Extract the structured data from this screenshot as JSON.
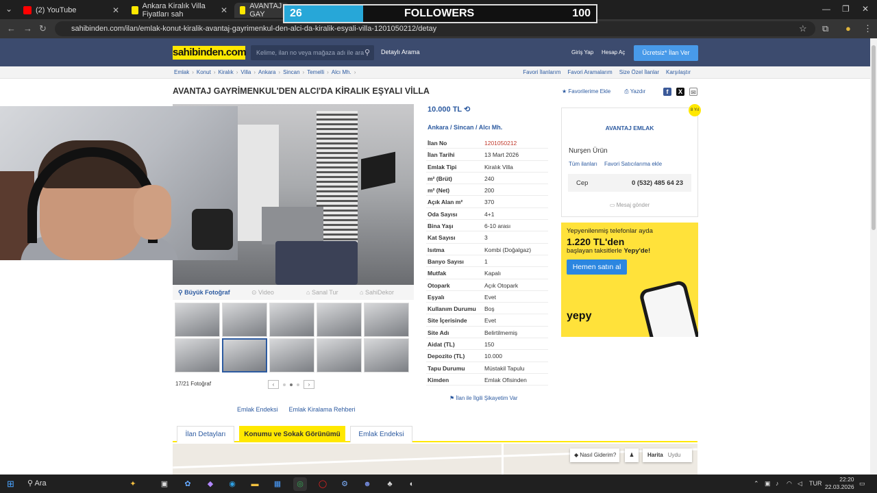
{
  "browser": {
    "tabs": [
      {
        "title": "(2) YouTube"
      },
      {
        "title": "Ankara Kiralık Villa Fiyatları sah"
      },
      {
        "title": "AVANTAJ GAY"
      }
    ],
    "url": "sahibinden.com/ilan/emlak-konut-kiralik-avantaj-gayrimenkul-den-alci-da-kiralik-esyali-villa-1201050212/detay"
  },
  "overlay": {
    "count": "26",
    "label": "FOLLOWERS",
    "goal": "100"
  },
  "header": {
    "logo": "sahibinden.com",
    "search_placeholder": "Kelime, ilan no veya mağaza adı ile ara",
    "advanced": "Detaylı Arama",
    "login": "Giriş Yap",
    "signup": "Hesap Aç",
    "post_button": "Ücretsiz* İlan Ver"
  },
  "breadcrumb": [
    "Emlak",
    "Konut",
    "Kiralık",
    "Villa",
    "Ankara",
    "Sincan",
    "Temelli",
    "Alcı Mh."
  ],
  "breadcrumb_right": [
    "Favori İlanlarım",
    "Favori Aramalarım",
    "Size Özel İlanlar",
    "Karşılaştır"
  ],
  "listing": {
    "title": "AVANTAJ GAYRİMENKUL'DEN ALCI'DA KİRALIK EŞYALI VİLLA",
    "favorite": "Favorilerime Ekle",
    "print": "Yazdır",
    "price": "10.000 TL",
    "location": [
      "Ankara",
      "Sincan",
      "Alcı Mh."
    ],
    "photo_tabs": {
      "big": "Büyük Fotoğraf",
      "video": "Video",
      "tour": "Sanal Tur",
      "dekor": "SahiDekor"
    },
    "photo_count": "17/21 Fotoğraf",
    "links": [
      "Emlak Endeksi",
      "Emlak Kiralama Rehberi"
    ],
    "complaint": "İlan ile İlgili Şikayetim Var",
    "details": [
      {
        "k": "İlan No",
        "v": "1201050212"
      },
      {
        "k": "İlan Tarihi",
        "v": "13 Mart 2026"
      },
      {
        "k": "Emlak Tipi",
        "v": "Kiralık Villa"
      },
      {
        "k": "m² (Brüt)",
        "v": "240"
      },
      {
        "k": "m² (Net)",
        "v": "200"
      },
      {
        "k": "Açık Alan m²",
        "v": "370"
      },
      {
        "k": "Oda Sayısı",
        "v": "4+1"
      },
      {
        "k": "Bina Yaşı",
        "v": "6-10 arası"
      },
      {
        "k": "Kat Sayısı",
        "v": "3"
      },
      {
        "k": "Isıtma",
        "v": "Kombi (Doğalgaz)"
      },
      {
        "k": "Banyo Sayısı",
        "v": "1"
      },
      {
        "k": "Mutfak",
        "v": "Kapalı"
      },
      {
        "k": "Otopark",
        "v": "Açık Otopark"
      },
      {
        "k": "Eşyalı",
        "v": "Evet"
      },
      {
        "k": "Kullanım Durumu",
        "v": "Boş"
      },
      {
        "k": "Site İçerisinde",
        "v": "Evet"
      },
      {
        "k": "Site Adı",
        "v": "Belirtilmemiş"
      },
      {
        "k": "Aidat (TL)",
        "v": "150"
      },
      {
        "k": "Depozito (TL)",
        "v": "10.000"
      },
      {
        "k": "Tapu Durumu",
        "v": "Müstakil Tapulu"
      },
      {
        "k": "Kimden",
        "v": "Emlak Ofisinden"
      }
    ]
  },
  "seller": {
    "agency": "AVANTAJ EMLAK",
    "name": "Nurşen Ürün",
    "all_listings": "Tüm ilanları",
    "fav_seller": "Favori Satıcılarıma ekle",
    "phone_label": "Cep",
    "phone": "0 (532) 485 64 23",
    "message": "Mesaj gönder",
    "badge": "8 Yıl"
  },
  "ad": {
    "line1": "Yepyenilenmiş telefonlar ayda",
    "line2": "1.220 TL'den",
    "line3a": "başlayan taksitlerle ",
    "line3b": "Yepy'de!",
    "button": "Hemen satın al",
    "brand": "yepy"
  },
  "bottom_tabs": [
    "İlan Detayları",
    "Konumu ve Sokak Görünümü",
    "Emlak Endeksi"
  ],
  "map": {
    "how": "Nasıl Giderim?",
    "map": "Harita",
    "sat": "Uydu"
  },
  "taskbar": {
    "search": "Ara",
    "lang": "TUR",
    "time": "22:20",
    "date": "22.03.2026"
  }
}
